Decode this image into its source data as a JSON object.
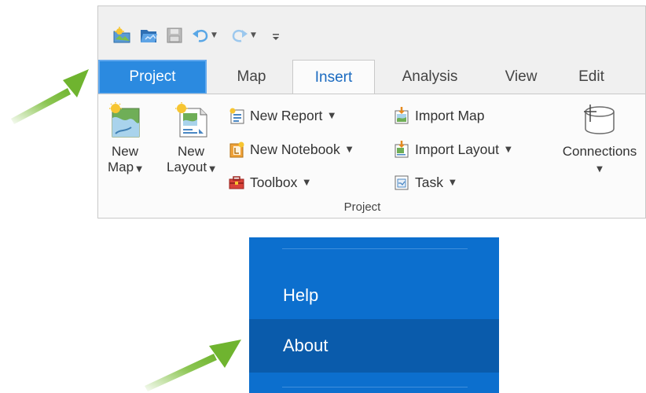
{
  "ribbon": {
    "quick_access": {
      "icons": [
        "new-project-icon",
        "open-project-icon",
        "save-project-icon",
        "undo-icon",
        "redo-icon",
        "customize-qat-icon"
      ]
    },
    "tabs": [
      {
        "key": "project",
        "label": "Project"
      },
      {
        "key": "map",
        "label": "Map"
      },
      {
        "key": "insert",
        "label": "Insert"
      },
      {
        "key": "analysis",
        "label": "Analysis"
      },
      {
        "key": "view",
        "label": "View"
      },
      {
        "key": "edit",
        "label": "Edit"
      }
    ],
    "active_tab": "Insert",
    "buttons": {
      "new_map": {
        "line1": "New",
        "line2": "Map"
      },
      "new_layout": {
        "line1": "New",
        "line2": "Layout"
      },
      "new_report": "New Report",
      "new_notebook": "New Notebook",
      "toolbox": "Toolbox",
      "import_map": "Import Map",
      "import_layout": "Import Layout",
      "task": "Task",
      "connections": "Connections"
    },
    "group_label": "Project"
  },
  "menu": {
    "items": [
      {
        "label": "Help",
        "active": false
      },
      {
        "label": "About",
        "active": true
      }
    ]
  },
  "colors": {
    "project_tab": "#2b8ae0",
    "menu_bg": "#0c6fce",
    "menu_active": "#0a5bab",
    "arrow": "#7fbf3f"
  }
}
